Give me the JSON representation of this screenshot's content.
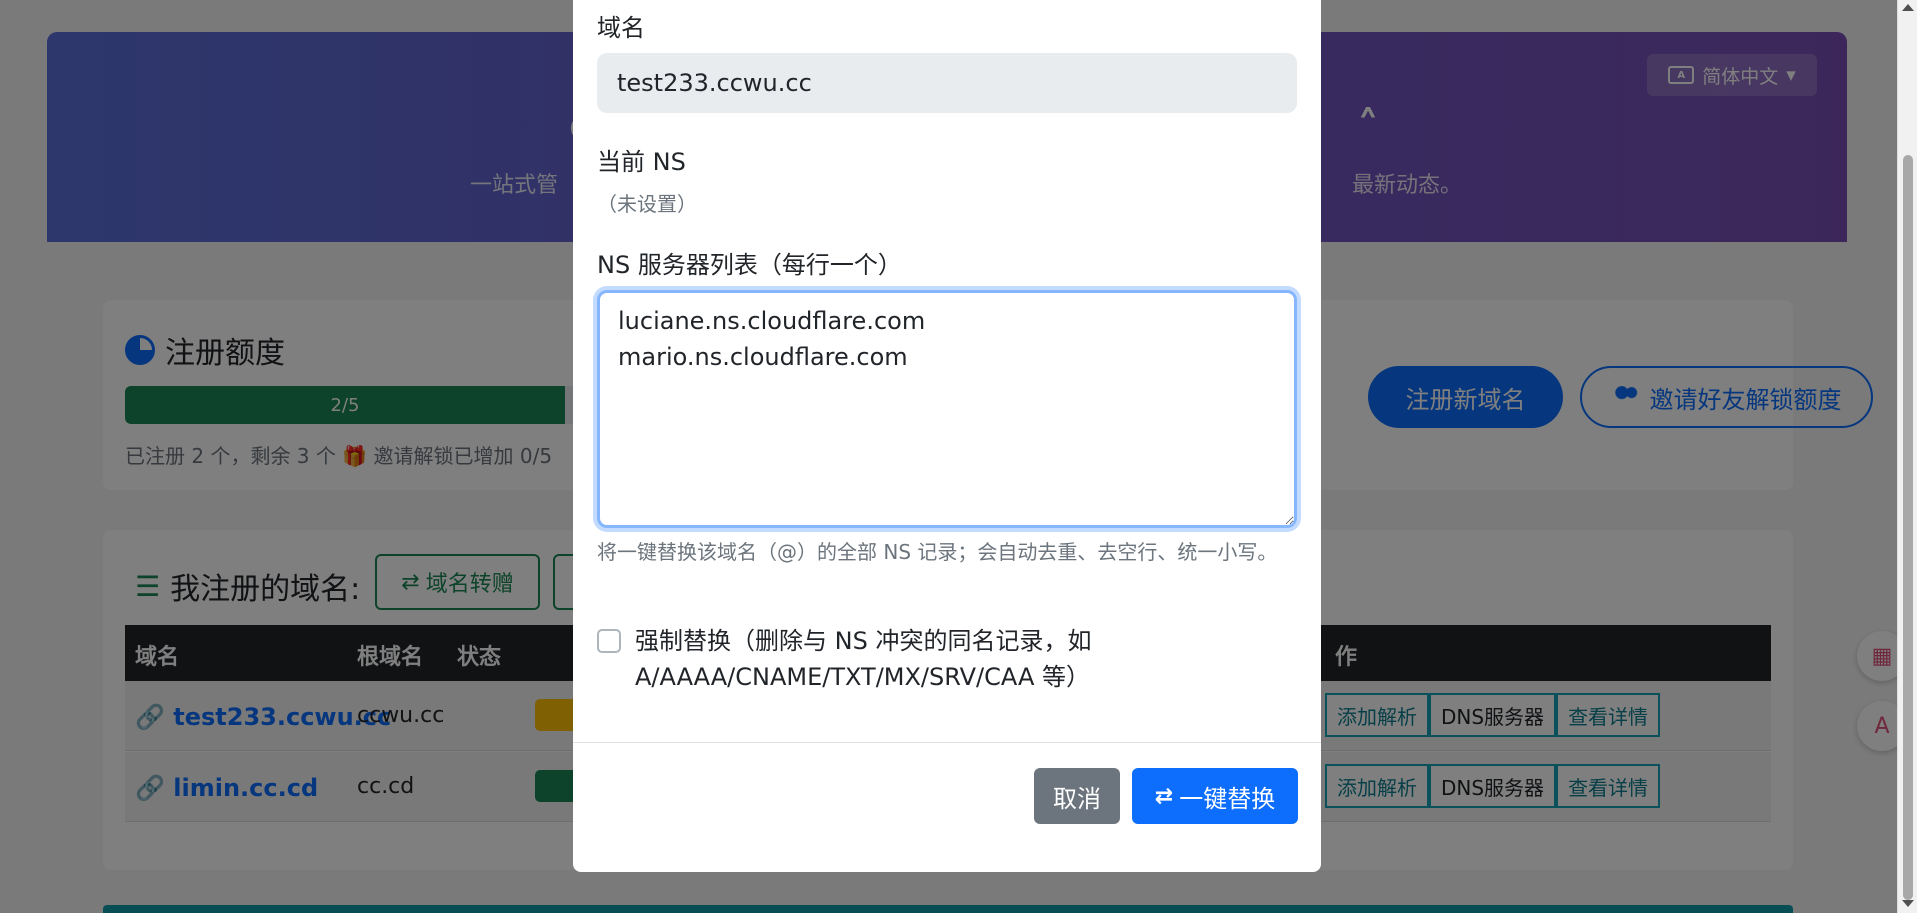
{
  "background": {
    "hero": {
      "title_left": "⊕",
      "title_right": "˄",
      "subtitle_left": "一站式管",
      "subtitle_right": "最新动态。",
      "language": "简体中文"
    },
    "quota": {
      "title": "注册额度",
      "progress_label": "2/5",
      "progress_fraction": 0.4,
      "note": "已注册 2 个，剩余 3 个  🎁 邀请解锁已增加 0/5",
      "register_button": "注册新域名",
      "invite_button": "邀请好友解锁额度"
    },
    "domains": {
      "title": "我注册的域名:",
      "transfer_button": "域名转赠",
      "columns": [
        "域名",
        "根域名",
        "状态",
        "作"
      ],
      "rows": [
        {
          "domain": "test233.ccwu.cc",
          "root": "ccwu.cc",
          "status": "warning"
        },
        {
          "domain": "limin.cc.cd",
          "root": "cc.cd",
          "status": "ok"
        }
      ],
      "actions": {
        "add": "添加解析",
        "dns": "DNS服务器",
        "view": "查看详情"
      }
    }
  },
  "modal": {
    "domain_label": "域名",
    "domain_value": "test233.ccwu.cc",
    "current_ns_label": "当前 NS",
    "current_ns_value": "（未设置）",
    "ns_list_label": "NS 服务器列表（每行一个）",
    "ns_list_value": "luciane.ns.cloudflare.com\nmario.ns.cloudflare.com",
    "help_text": "将一键替换该域名（@）的全部 NS 记录；会自动去重、去空行、统一小写。",
    "force_label": "强制替换（删除与 NS 冲突的同名记录，如 A/AAAA/CNAME/TXT/MX/SRV/CAA 等）",
    "cancel_button": "取消",
    "replace_button": "一键替换"
  },
  "colors": {
    "primary": "#0d6efd",
    "success": "#198754",
    "secondary": "#6c757d"
  }
}
